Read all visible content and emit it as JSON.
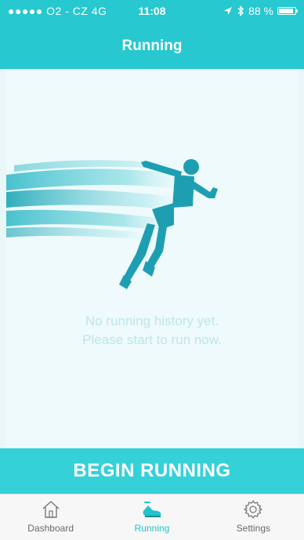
{
  "status_bar": {
    "carrier": "●●●●● O2 - CZ  4G",
    "time": "11:08",
    "battery": "88 %",
    "battery_level": 0.88
  },
  "nav": {
    "title": "Running"
  },
  "main": {
    "empty_line1": "No running history yet.",
    "empty_line2": "Please start to run now."
  },
  "cta": {
    "label": "BEGIN RUNNING"
  },
  "tabs": [
    {
      "label": "Dashboard",
      "icon": "home-icon"
    },
    {
      "label": "Running",
      "icon": "running-shoe-icon"
    },
    {
      "label": "Settings",
      "icon": "gear-icon"
    }
  ],
  "colors": {
    "accent": "#27c8cf",
    "button": "#35d1d9",
    "background": "#eefafb"
  }
}
